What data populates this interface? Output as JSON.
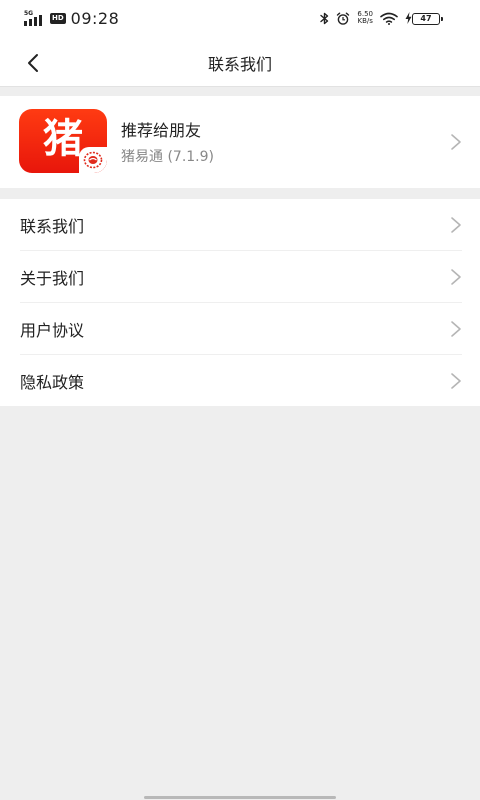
{
  "status_bar": {
    "network": "5G",
    "hd": "HD",
    "time": "09:28",
    "speed_value": "6.50",
    "speed_unit": "KB/s",
    "battery": "47",
    "icons": [
      "bluetooth-icon",
      "alarm-icon",
      "wifi-icon",
      "charging-icon"
    ]
  },
  "header": {
    "title": "联系我们",
    "back_icon": "chevron-left-icon"
  },
  "app_card": {
    "logo_char": "猪",
    "title": "推荐给朋友",
    "subtitle": "猪易通 (7.1.9)",
    "brand_color": "#ee2a0f"
  },
  "menu": {
    "items": [
      {
        "label": "联系我们"
      },
      {
        "label": "关于我们"
      },
      {
        "label": "用户协议"
      },
      {
        "label": "隐私政策"
      }
    ]
  },
  "colors": {
    "background": "#eeeeee",
    "surface": "#ffffff",
    "text": "#222222",
    "secondary_text": "#888888",
    "chevron": "#b5b5b5"
  }
}
